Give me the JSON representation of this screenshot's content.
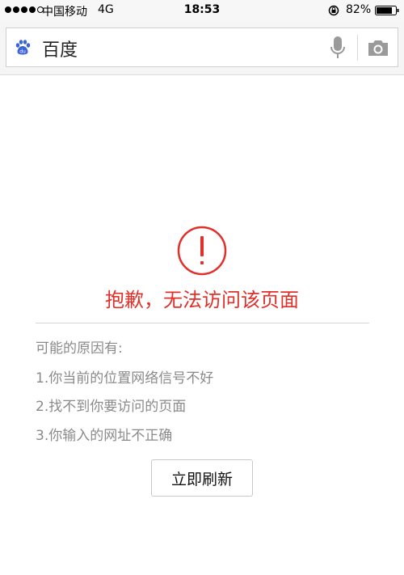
{
  "status_bar": {
    "carrier": "中国移动",
    "network": "4G",
    "time": "18:53",
    "battery": "82%"
  },
  "search": {
    "text": "百度",
    "icons": [
      "baidu-paw-icon",
      "mic-icon",
      "camera-icon"
    ]
  },
  "error": {
    "title": "抱歉，无法访问该页面",
    "accent_color": "#e0302a",
    "reasons_title": "可能的原因有:",
    "reasons": [
      "1.你当前的位置网络信号不好",
      "2.找不到你要访问的页面",
      "3.你输入的网址不正确"
    ],
    "refresh_label": "立即刷新"
  }
}
